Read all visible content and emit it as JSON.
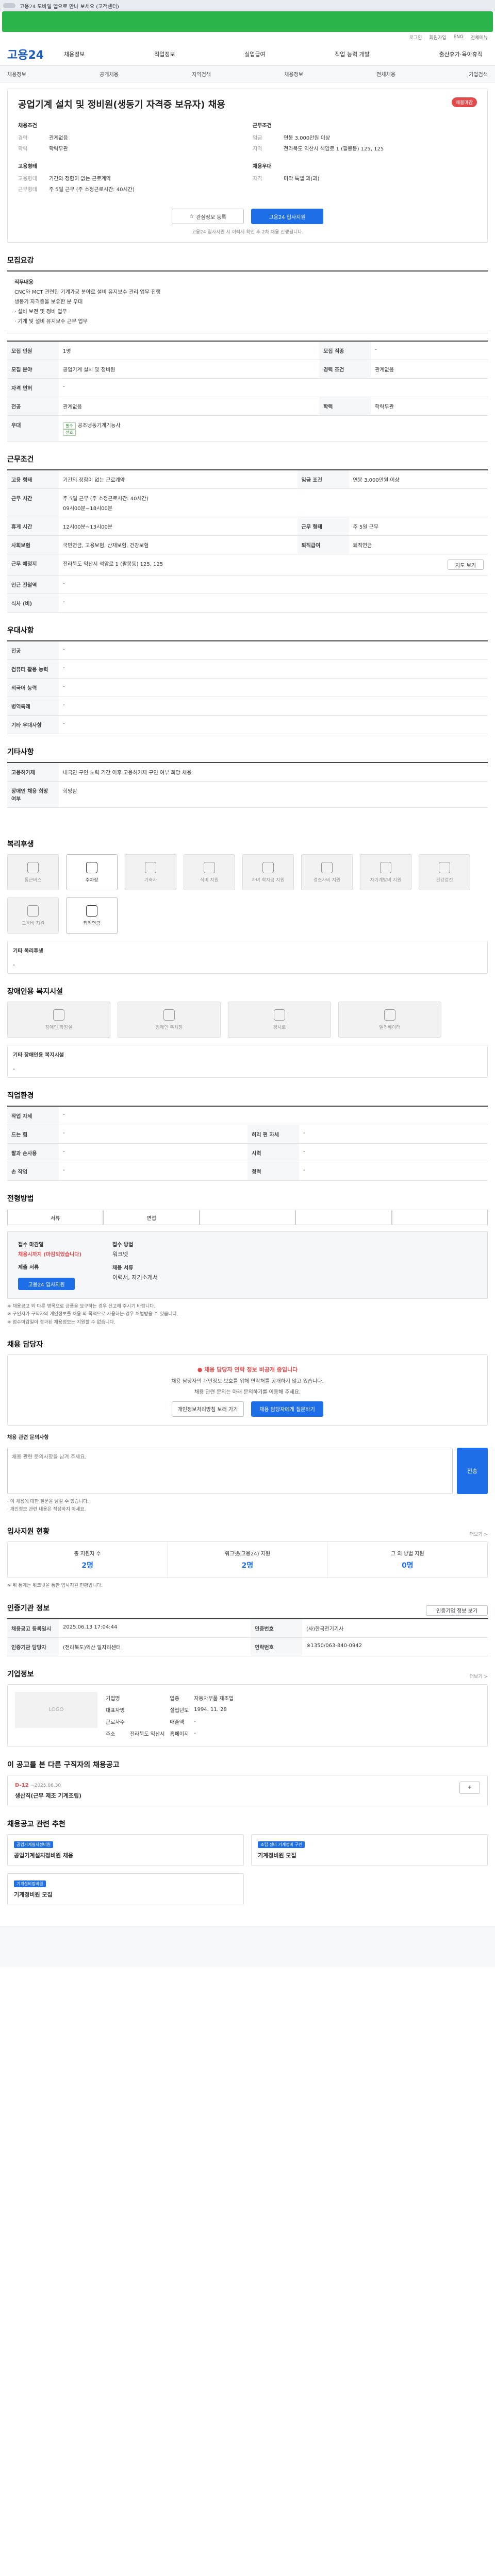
{
  "topbar": {
    "text": "고용24 모바일 앱으로 만나 보세요 (고객센터)"
  },
  "util": [
    "로그인",
    "회원가입",
    "ENG",
    "전체메뉴"
  ],
  "logo": "고용24",
  "gnb": [
    "채용정보",
    "직업정보",
    "실업급여",
    "직업 능력 개발",
    "출산휴가·육아휴직"
  ],
  "subnav": [
    "채용정보",
    "공개채용",
    "지역검색",
    "채용정보",
    "전체채용",
    "기업검색"
  ],
  "job": {
    "title": "공업기계 설치 및 정비원(생동기 자격증 보유자) 채용",
    "badge": "채용마감",
    "left": {
      "h": "채용조건",
      "rows": [
        [
          "경력",
          "관계없음"
        ],
        [
          "학력",
          "학력무관"
        ]
      ]
    },
    "right": {
      "h": "근무조건",
      "rows": [
        [
          "임금",
          "연봉 3,000만원 이상"
        ],
        [
          "지역",
          "전라북도 익산시 석암로 1 (팔봉동) 125, 125"
        ]
      ]
    },
    "left2": {
      "h": "고용형태",
      "rows": [
        [
          "고용형태",
          "기간의 정함이 없는 근로계약"
        ],
        [
          "근무형태",
          "주 5일 근무 (주 소정근로시간: 40시간)"
        ]
      ]
    },
    "right2": {
      "h": "채용우대",
      "rows": [
        [
          "자격",
          "미작 특별 과(과)"
        ]
      ]
    },
    "btn_interest": "관심정보 등록",
    "btn_apply": "고용24 입사지원",
    "note": "고용24 입사지원 시 이력서 확인 후 2차 채용 진행됩니다."
  },
  "s1": {
    "h": "모집요강",
    "body": [
      "직무내용",
      "CNC와 MCT 관련된 기계가공 분야로 설비 유지보수 관리 업무 진행",
      "생동기 자격증을 보유한 분 우대",
      "· 설비 보전 및 정비 업무",
      "· 기계 및 설비 유지보수 근무 업무"
    ],
    "rows": [
      [
        "모집 인원",
        "1명",
        "모집 직종",
        "-"
      ],
      [
        "모집 분야",
        "공업기계 설치 및 정비원",
        "경력 조건",
        "관계없음"
      ],
      [
        "자격 면허",
        "-",
        "",
        ""
      ],
      [
        "전공",
        "관계없음",
        "학력",
        "학력무관"
      ],
      [
        "우대",
        "공조냉동기계기능사",
        "",
        ""
      ]
    ],
    "chips": [
      "필수",
      "선호"
    ]
  },
  "s2": {
    "h": "근무조건",
    "rows": [
      [
        "고용 형태",
        "기간의 정함이 없는 근로계약",
        "임금 조건",
        "연봉 3,000만원 이상"
      ],
      [
        "근무 시간",
        "주 5일 근무 (주 소정근로시간: 40시간)",
        "",
        ""
      ],
      [
        "휴게 시간",
        "12시00분~13시00분",
        "근무 형태",
        "주 5일 근무"
      ],
      [
        "사회보험",
        "국민연금, 고용보험, 산재보험, 건강보험",
        "퇴직급여",
        "퇴직연금"
      ],
      [
        "근무 예정지",
        "전라북도 익산시 석암로 1 (팔봉동) 125, 125",
        "",
        ""
      ],
      [
        "인근 전철역",
        "-",
        "",
        ""
      ],
      [
        "식사 (비)",
        "-",
        "",
        ""
      ]
    ],
    "worktime": "09시00분~18시00분",
    "mapbtn": "지도 보기"
  },
  "s3": {
    "h": "우대사항",
    "rows": [
      [
        "전공",
        "-"
      ],
      [
        "컴퓨터 활용 능력",
        "-"
      ],
      [
        "외국어 능력",
        "-"
      ],
      [
        "병역특례",
        "-"
      ],
      [
        "기타 우대사항",
        "-"
      ]
    ]
  },
  "s4": {
    "h": "기타사항",
    "rows": [
      [
        "고용허가제",
        "내국인 구인 노력 기간 이후 고용허가제 구인 여부 희망 채용"
      ],
      [
        "장애인 채용 희망 여부",
        "희망함"
      ]
    ]
  },
  "s5": {
    "h": "복리후생",
    "items": [
      "통근버스",
      "주차장",
      "기숙사",
      "식비 지원",
      "자녀 학자금 지원",
      "경조사비 지원",
      "자기계발비 지원",
      "건강검진",
      "교육비 지원",
      "퇴직연금"
    ],
    "sum_h": "기타 복리후생",
    "sum": "-"
  },
  "s6": {
    "h": "장애인용 복지시설",
    "items": [
      "장애인 화장실",
      "장애인 주차장",
      "경사로",
      "엘리베이터"
    ],
    "sum_h": "기타 장애인용 복지시설",
    "sum": "-"
  },
  "s7": {
    "h": "직업환경",
    "rows": [
      [
        "작업 자세",
        "-",
        "",
        ""
      ],
      [
        "드는 힘",
        "-",
        "허리 편 자세",
        "-"
      ],
      [
        "팔과 손사용",
        "-",
        "시력",
        "-"
      ],
      [
        "손 작업",
        "-",
        "청력",
        "-"
      ]
    ]
  },
  "s8": {
    "h": "전형방법",
    "steps": [
      "서류",
      "면접",
      "",
      "",
      ""
    ],
    "a": [
      [
        "접수 마감일",
        "채용시까지 (마감되었습니다)",
        "접수 방법",
        "워크넷"
      ],
      [
        "제출 서류",
        "",
        "채용 서류",
        "이력서, 자기소개서"
      ]
    ],
    "apply_btn": "고용24 입사지원",
    "notes": [
      "※ 채용공고 외 다른 명목으로 금품을 요구하는 경우 신고해 주시기 바랍니다.",
      "※ 구인자가 구직자의 개인정보를 채용 외 목적으로 사용하는 경우 처벌받을 수 있습니다.",
      "※ 접수마감일이 경과된 채용정보는 지원할 수 없습니다."
    ]
  },
  "s9": {
    "h": "채용 담당자",
    "alert": "채용 담당자 연락 정보 비공개 중입니다",
    "p1": "채용 담당자의 개인정보 보호를 위해 연락처를 공개하지 않고 있습니다.",
    "p2": "채용 관련 문의는 아래 문의하기를 이용해 주세요.",
    "b1": "개인정보처리방침 보러 가기",
    "b2": "채용 담당자에게 질문하기",
    "qa_h": "채용 관련 문의사항",
    "placeholder": "채용 관련 문의사항을 남겨 주세요.",
    "send": "전송",
    "qa_notes": [
      "· 이 채용에 대한 질문을 남길 수 있습니다.",
      "· 개인정보 관련 내용은 작성하지 마세요."
    ]
  },
  "s10": {
    "h": "입사지원 현황",
    "more": "더보기 >",
    "stats": [
      [
        "총 지원자 수",
        "2명"
      ],
      [
        "워크넷(고용24) 지원",
        "2명"
      ],
      [
        "그 외 방법 지원",
        "0명"
      ]
    ],
    "note": "※ 위 통계는 워크넷을 통한 입사지원 현황입니다."
  },
  "s11": {
    "h": "인증기관 정보",
    "btn": "인증기업 정보 보기",
    "rows": [
      [
        "채용공고 등록일시",
        "2025.06.13 17:04:44",
        "인증번호",
        "(사)한국전기기사"
      ],
      [
        "인증기관 담당자",
        "(전라북도)익산 일자리센터",
        "연락번호",
        "※1350/063-840-0942"
      ]
    ]
  },
  "s12": {
    "h": "기업정보",
    "more": "더보기 >",
    "logo": "LOGO",
    "rows": [
      [
        "기업명",
        "",
        "업종",
        "자동차부품 제조업"
      ],
      [
        "대표자명",
        "",
        "설립년도",
        "1994. 11. 28"
      ],
      [
        "근로자수",
        "",
        "매출액",
        "-"
      ],
      [
        "주소",
        "전라북도 익산시",
        "홈페이지",
        "-"
      ]
    ]
  },
  "s13": {
    "h": "이 공고를 본 다른 구직자의 채용공고",
    "d": "D-12",
    "date": "~2025.06.30",
    "title": "생산직(근무 제조 기계조립)",
    "more": "+"
  },
  "s14": {
    "h": "채용공고 관련 추천",
    "jobs": [
      [
        "공업기계설치정비원",
        "공업기계설치정비원 채용"
      ],
      [
        "조립 정비 기계정비 구인",
        "기계정비원 모집"
      ],
      [
        "기계설비정비원",
        "기계정비원 모집"
      ]
    ]
  }
}
